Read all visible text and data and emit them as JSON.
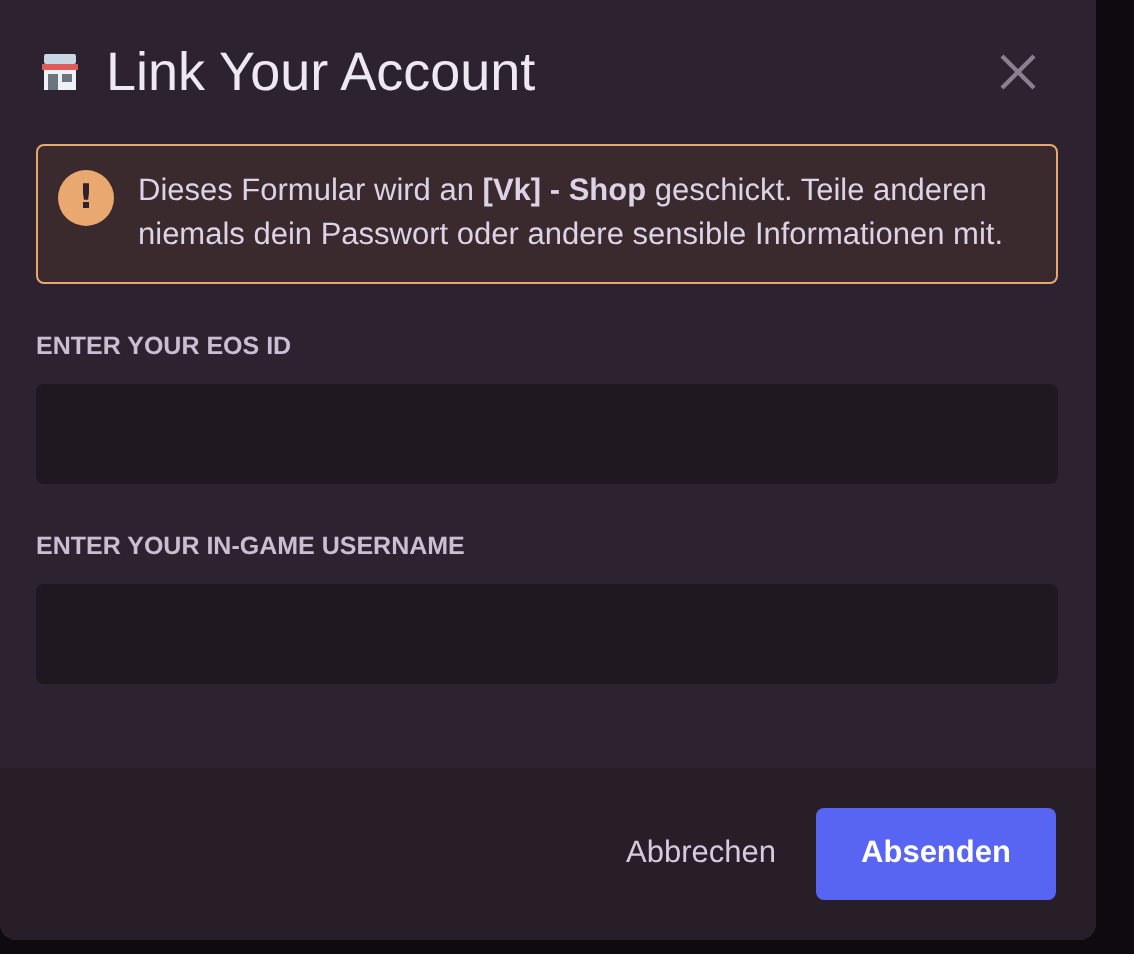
{
  "dialog": {
    "title": "Link Your Account"
  },
  "notice": {
    "text": "Dieses Formular wird an **[Vk] - Shop** geschickt. Teile anderen niemals dein Passwort oder andere sensible Informationen mit.",
    "icon": "!"
  },
  "fields": [
    {
      "label": "ENTER YOUR EOS ID"
    },
    {
      "label": "ENTER YOUR IN-GAME USERNAME"
    }
  ],
  "buttons": [
    {
      "label": "Abbrechen",
      "kind": "link"
    },
    {
      "label": "Absenden",
      "kind": "primary"
    }
  ]
}
